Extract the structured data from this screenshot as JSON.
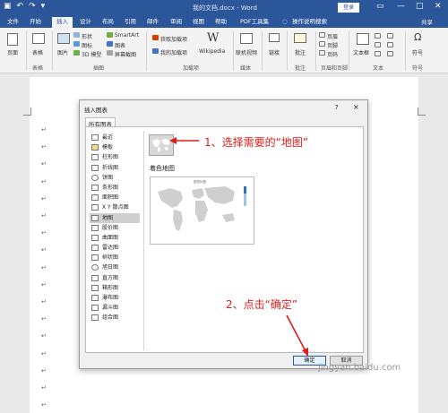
{
  "titlebar": {
    "doc_title": "我的文档.docx - Word",
    "login": "登录"
  },
  "tabs": [
    "文件",
    "开始",
    "插入",
    "设计",
    "布局",
    "引用",
    "邮件",
    "审阅",
    "视图",
    "帮助",
    "PDF工具集",
    "操作说明搜索"
  ],
  "active_tab": "插入",
  "share": "共享",
  "ribbon": {
    "page": "页面",
    "table": "表格",
    "picture": "图片",
    "shapes": "形状",
    "icons": "图标",
    "model3d": "3D 模型",
    "smartart": "SmartArt",
    "chart": "图表",
    "screenshot": "屏幕截图",
    "get_addins": "获取加载项",
    "my_addins": "我的加载项",
    "wikipedia": "Wikipedia",
    "online_video": "联机视频",
    "link": "链接",
    "comment": "批注",
    "header": "页眉",
    "footer": "页脚",
    "page_number": "页码",
    "textbox": "文本框",
    "symbol": "符号",
    "groups": {
      "table": "表格",
      "illustrations": "插图",
      "addins": "加载项",
      "media": "媒体",
      "comments": "批注",
      "header_footer": "页眉和页脚",
      "text": "文本",
      "symbols": "符号"
    }
  },
  "dialog": {
    "title": "插入图表",
    "help": "?",
    "close": "×",
    "tab": "所有图表",
    "types": [
      "最近",
      "模板",
      "柱形图",
      "折线图",
      "饼图",
      "条形图",
      "面积图",
      "X Y 散点图",
      "地图",
      "股价图",
      "曲面图",
      "雷达图",
      "树状图",
      "旭日图",
      "直方图",
      "箱形图",
      "瀑布图",
      "漏斗图",
      "组合图"
    ],
    "selected": "地图",
    "map_subtype": "着色地图",
    "preview_title": "图表标题",
    "ok": "确定",
    "cancel": "取消"
  },
  "annotations": {
    "step1": "1、选择需要的“地图”",
    "step2": "2、点击“确定”"
  },
  "watermark": "jingyan.baidu.com",
  "colors": {
    "accent": "#2b579a",
    "annotation": "#e01b1b"
  }
}
